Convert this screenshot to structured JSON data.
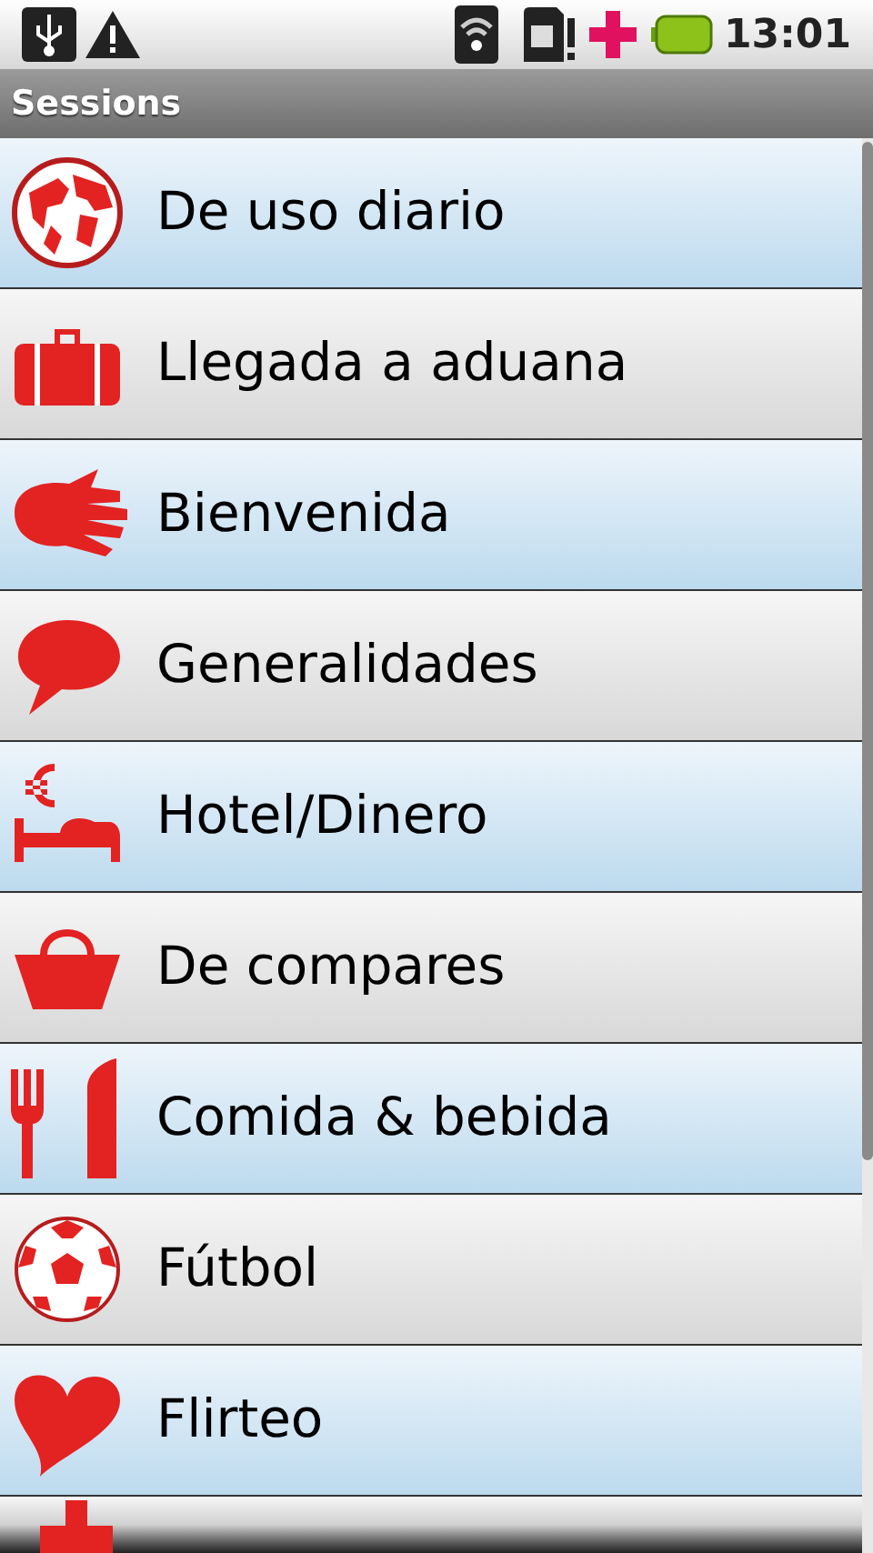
{
  "status_bar": {
    "time": "13:01"
  },
  "title_bar": {
    "title": "Sessions"
  },
  "sessions": [
    {
      "label": "De uso diario"
    },
    {
      "label": "Llegada a aduana"
    },
    {
      "label": "Bienvenida"
    },
    {
      "label": "Generalidades"
    },
    {
      "label": "Hotel/Dinero"
    },
    {
      "label": "De compares"
    },
    {
      "label": "Comida & bebida"
    },
    {
      "label": "Fútbol"
    },
    {
      "label": "Flirteo"
    }
  ]
}
